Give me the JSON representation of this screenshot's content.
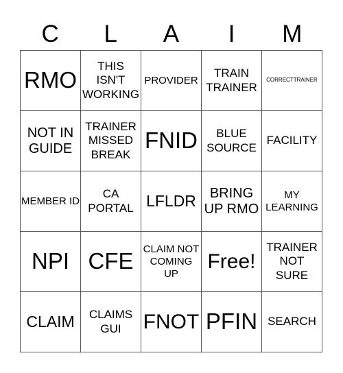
{
  "title_letters": [
    "C",
    "L",
    "A",
    "I",
    "M"
  ],
  "cells": [
    {
      "text": "RMO",
      "size": "fs-xxl",
      "free": false
    },
    {
      "text": "THIS ISN'T WORKING",
      "size": "fs-m",
      "free": false
    },
    {
      "text": "PROVIDER",
      "size": "fs-s",
      "free": false
    },
    {
      "text": "TRAIN TRAINER",
      "size": "fs-m",
      "free": false
    },
    {
      "text": "CORRECTTRAINER",
      "size": "fs-xs",
      "free": false
    },
    {
      "text": "NOT IN GUIDE",
      "size": "fs-ml",
      "free": false
    },
    {
      "text": "TRAINER MISSED BREAK",
      "size": "fs-m",
      "free": false
    },
    {
      "text": "FNID",
      "size": "fs-xxl",
      "free": false
    },
    {
      "text": "BLUE SOURCE",
      "size": "fs-m",
      "free": false
    },
    {
      "text": "FACILITY",
      "size": "fs-m",
      "free": false
    },
    {
      "text": "MEMBER ID",
      "size": "fs-s",
      "free": false
    },
    {
      "text": "CA PORTAL",
      "size": "fs-m",
      "free": false
    },
    {
      "text": "LFLDR",
      "size": "fs-l",
      "free": false
    },
    {
      "text": "BRING UP RMO",
      "size": "fs-ml",
      "free": false
    },
    {
      "text": "MY LEARNING",
      "size": "fs-s",
      "free": false
    },
    {
      "text": "NPI",
      "size": "fs-xxl",
      "free": false
    },
    {
      "text": "CFE",
      "size": "fs-xxl",
      "free": false
    },
    {
      "text": "CLAIM NOT COMING UP",
      "size": "fs-s",
      "free": false
    },
    {
      "text": "Free!",
      "size": "fs-xl",
      "free": true
    },
    {
      "text": "TRAINER NOT SURE",
      "size": "fs-m",
      "free": false
    },
    {
      "text": "CLAIM",
      "size": "fs-l",
      "free": false
    },
    {
      "text": "CLAIMS GUI",
      "size": "fs-m",
      "free": false
    },
    {
      "text": "FNOT",
      "size": "fs-xl",
      "free": false
    },
    {
      "text": "PFIN",
      "size": "fs-xxl",
      "free": false
    },
    {
      "text": "SEARCH",
      "size": "fs-m",
      "free": false
    }
  ]
}
